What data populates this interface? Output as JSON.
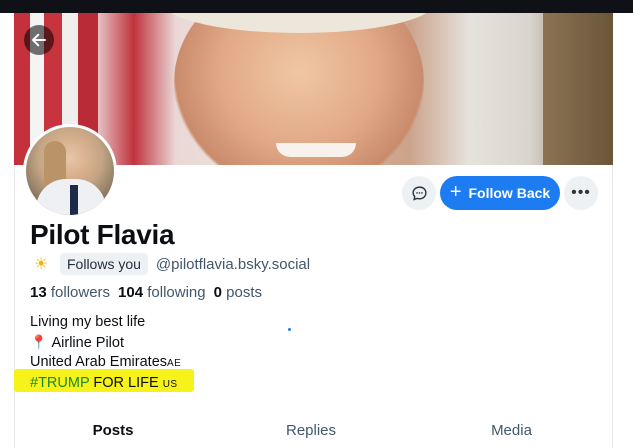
{
  "profile": {
    "display_name": "Pilot Flavia",
    "follows_you_label": "Follows you",
    "handle": "@pilotflavia.bsky.social",
    "stats": {
      "followers_count": "13",
      "followers_label": "followers",
      "following_count": "104",
      "following_label": "following",
      "posts_count": "0",
      "posts_label": "posts"
    },
    "bio": {
      "line1": "Living my best life",
      "line2": "Airline Pilot",
      "line3": "United Arab Emirates",
      "line3_flag": "AE",
      "line4_hashtag": "#TRUMP",
      "line4_rest": " FOR LIFE ",
      "line4_flag": "US"
    }
  },
  "actions": {
    "follow_back_label": "Follow Back"
  },
  "tabs": [
    {
      "label": "Posts",
      "active": true
    },
    {
      "label": "Replies",
      "active": false
    },
    {
      "label": "Media",
      "active": false
    }
  ],
  "icons": {
    "back": "arrow-left-icon",
    "message": "chat-bubble-icon",
    "follow": "plus-icon",
    "more": "ellipsis-icon",
    "emoji": "sun-behind-cloud-icon",
    "pin": "round-pushpin-icon"
  },
  "colors": {
    "accent": "#1d7cf2",
    "highlight": "#f7f21a",
    "hashtag": "#1a8a2c",
    "muted_text": "#42576c"
  }
}
